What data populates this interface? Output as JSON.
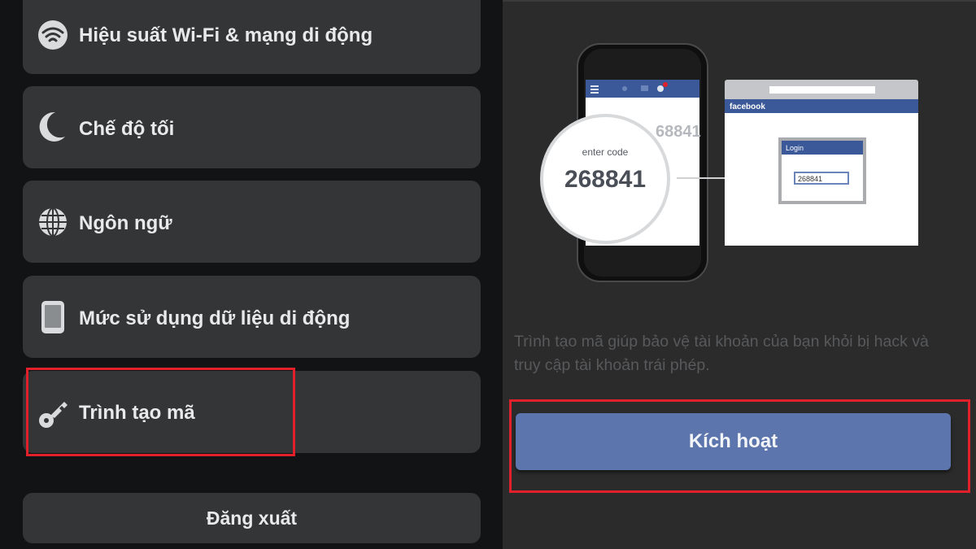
{
  "menu": {
    "items": [
      {
        "label": "Hiệu suất Wi-Fi & mạng di động",
        "icon": "wifi-icon"
      },
      {
        "label": "Chế độ tối",
        "icon": "moon-icon"
      },
      {
        "label": "Ngôn ngữ",
        "icon": "globe-icon"
      },
      {
        "label": "Mức sử dụng dữ liệu di động",
        "icon": "phone-icon"
      },
      {
        "label": "Trình tạo mã",
        "icon": "key-icon"
      }
    ],
    "logout_label": "Đăng xuất"
  },
  "illustration": {
    "enter_code_label": "enter code",
    "code": "268841",
    "code_partial": "68841",
    "browser_brand": "facebook",
    "login_label": "Login",
    "login_code": "268841"
  },
  "code_generator": {
    "description": "Trình tạo mã giúp bảo vệ tài khoản của bạn khỏi bị hack và truy cập tài khoản trái phép.",
    "activate_label": "Kích hoạt"
  },
  "colors": {
    "highlight": "#e0202a",
    "button": "#5c75ad",
    "facebook_blue": "#3b5998"
  }
}
